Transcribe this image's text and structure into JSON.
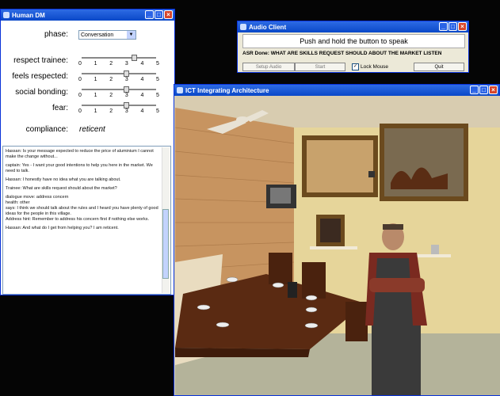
{
  "dm": {
    "title": "Human DM",
    "phase_label": "phase:",
    "phase_value": "Conversation",
    "sliders": [
      {
        "label": "respect trainee:",
        "value": 3.5,
        "ticks": [
          "0",
          "1",
          "2",
          "3",
          "4",
          "5"
        ]
      },
      {
        "label": "feels respected:",
        "value": 3,
        "ticks": [
          "0",
          "1",
          "2",
          "3",
          "4",
          "5"
        ]
      },
      {
        "label": "social bonding:",
        "value": 3,
        "ticks": [
          "0",
          "1",
          "2",
          "3",
          "4",
          "5"
        ]
      },
      {
        "label": "fear:",
        "value": 3,
        "ticks": [
          "0",
          "1",
          "2",
          "3",
          "4",
          "5"
        ]
      }
    ],
    "compliance_label": "compliance:",
    "compliance_value": "reticent",
    "log": [
      "Hassan: Is your message expected to reduce the price of aluminium I cannot make the change without...",
      "captain: Yes - I want your good intentions to help you here in the market. We need to talk.",
      "Hassan: I honestly have no idea what you are talking about.",
      "Trainee: What are skills request should about the market?",
      "dialogue move: address concern\nhealth: other\nsays: I think we should talk about the rules and I heard you have plenty of good ideas for the people in this village.\nAddress hint: Remember to address his concern first if nothing else works.",
      "Hassan: And what do I get from helping you? I am reticent."
    ]
  },
  "audio": {
    "title": "Audio Client",
    "push_text": "Push and hold the button to speak",
    "asr_text": "ASR Done: WHAT ARE SKILLS REQUEST SHOULD ABOUT THE MARKET LISTEN",
    "setup_label": "Setup Audio",
    "start_label": "Start",
    "lock_label": "Lock Mouse",
    "lock_checked": true,
    "quit_label": "Quit"
  },
  "viewer": {
    "title": "ICT Integrating Architecture"
  }
}
